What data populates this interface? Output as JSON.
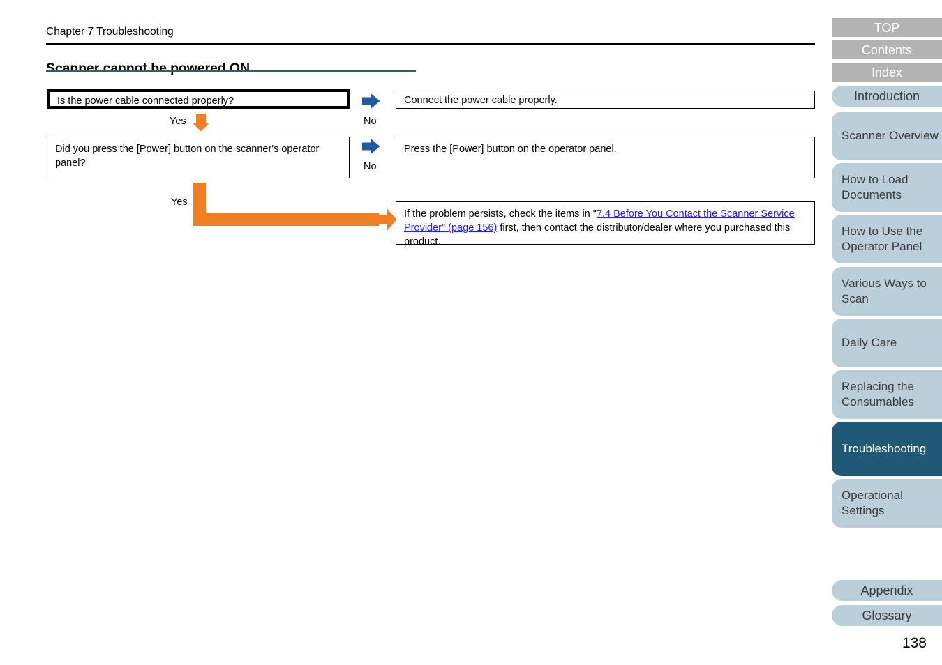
{
  "header": {
    "chapter": "Chapter 7 Troubleshooting",
    "title": "Scanner cannot be powered ON."
  },
  "flow": {
    "question_1": "Is the power cable connected properly?",
    "answer_1": "Connect the power cable properly.",
    "question_2": "Did you press the [Power] button on the scanner's operator panel?",
    "answer_2": "Press the [Power] button on the operator panel.",
    "final_note": {
      "before_link": "If the problem persists, check the items in \"",
      "link": "7.4 Before You Contact the Scanner Service Provider\" (page 156)",
      "after_link": " first, then contact the distributor/dealer where you purchased this product."
    },
    "labels": {
      "yes_1": "Yes",
      "no_1": "No",
      "no_2": "No",
      "yes_2": "Yes"
    },
    "icons": {
      "blue_arrow_1": "arrow-right-icon",
      "blue_arrow_2": "arrow-right-icon",
      "orange_down": "arrow-down-icon",
      "orange_elbow": "arrow-elbow-right-icon"
    }
  },
  "sidebar": {
    "top_links": [
      {
        "label": "TOP"
      },
      {
        "label": "Contents"
      },
      {
        "label": "Index"
      }
    ],
    "chapters": [
      {
        "label": "Introduction",
        "active": false
      },
      {
        "label": "Scanner Overview",
        "active": false
      },
      {
        "label": "How to Load Documents",
        "active": false
      },
      {
        "label": "How to Use the Operator Panel",
        "active": false
      },
      {
        "label": "Various Ways to Scan",
        "active": false
      },
      {
        "label": "Daily Care",
        "active": false
      },
      {
        "label": "Replacing the Consumables",
        "active": false
      },
      {
        "label": "Troubleshooting",
        "active": true
      },
      {
        "label": "Operational Settings",
        "active": false
      }
    ],
    "bottom_links": [
      {
        "label": "Appendix"
      },
      {
        "label": "Glossary"
      }
    ]
  },
  "footer": {
    "page_number": "138"
  },
  "colors": {
    "title_rule": "#2d5d78",
    "blue_arrow": "#1f5ba3",
    "orange_arrow": "#ef7f22",
    "nav_gray": "#b3b3b3",
    "nav_blue": "#bacfda",
    "nav_active": "#205878",
    "link": "#2222dd"
  }
}
